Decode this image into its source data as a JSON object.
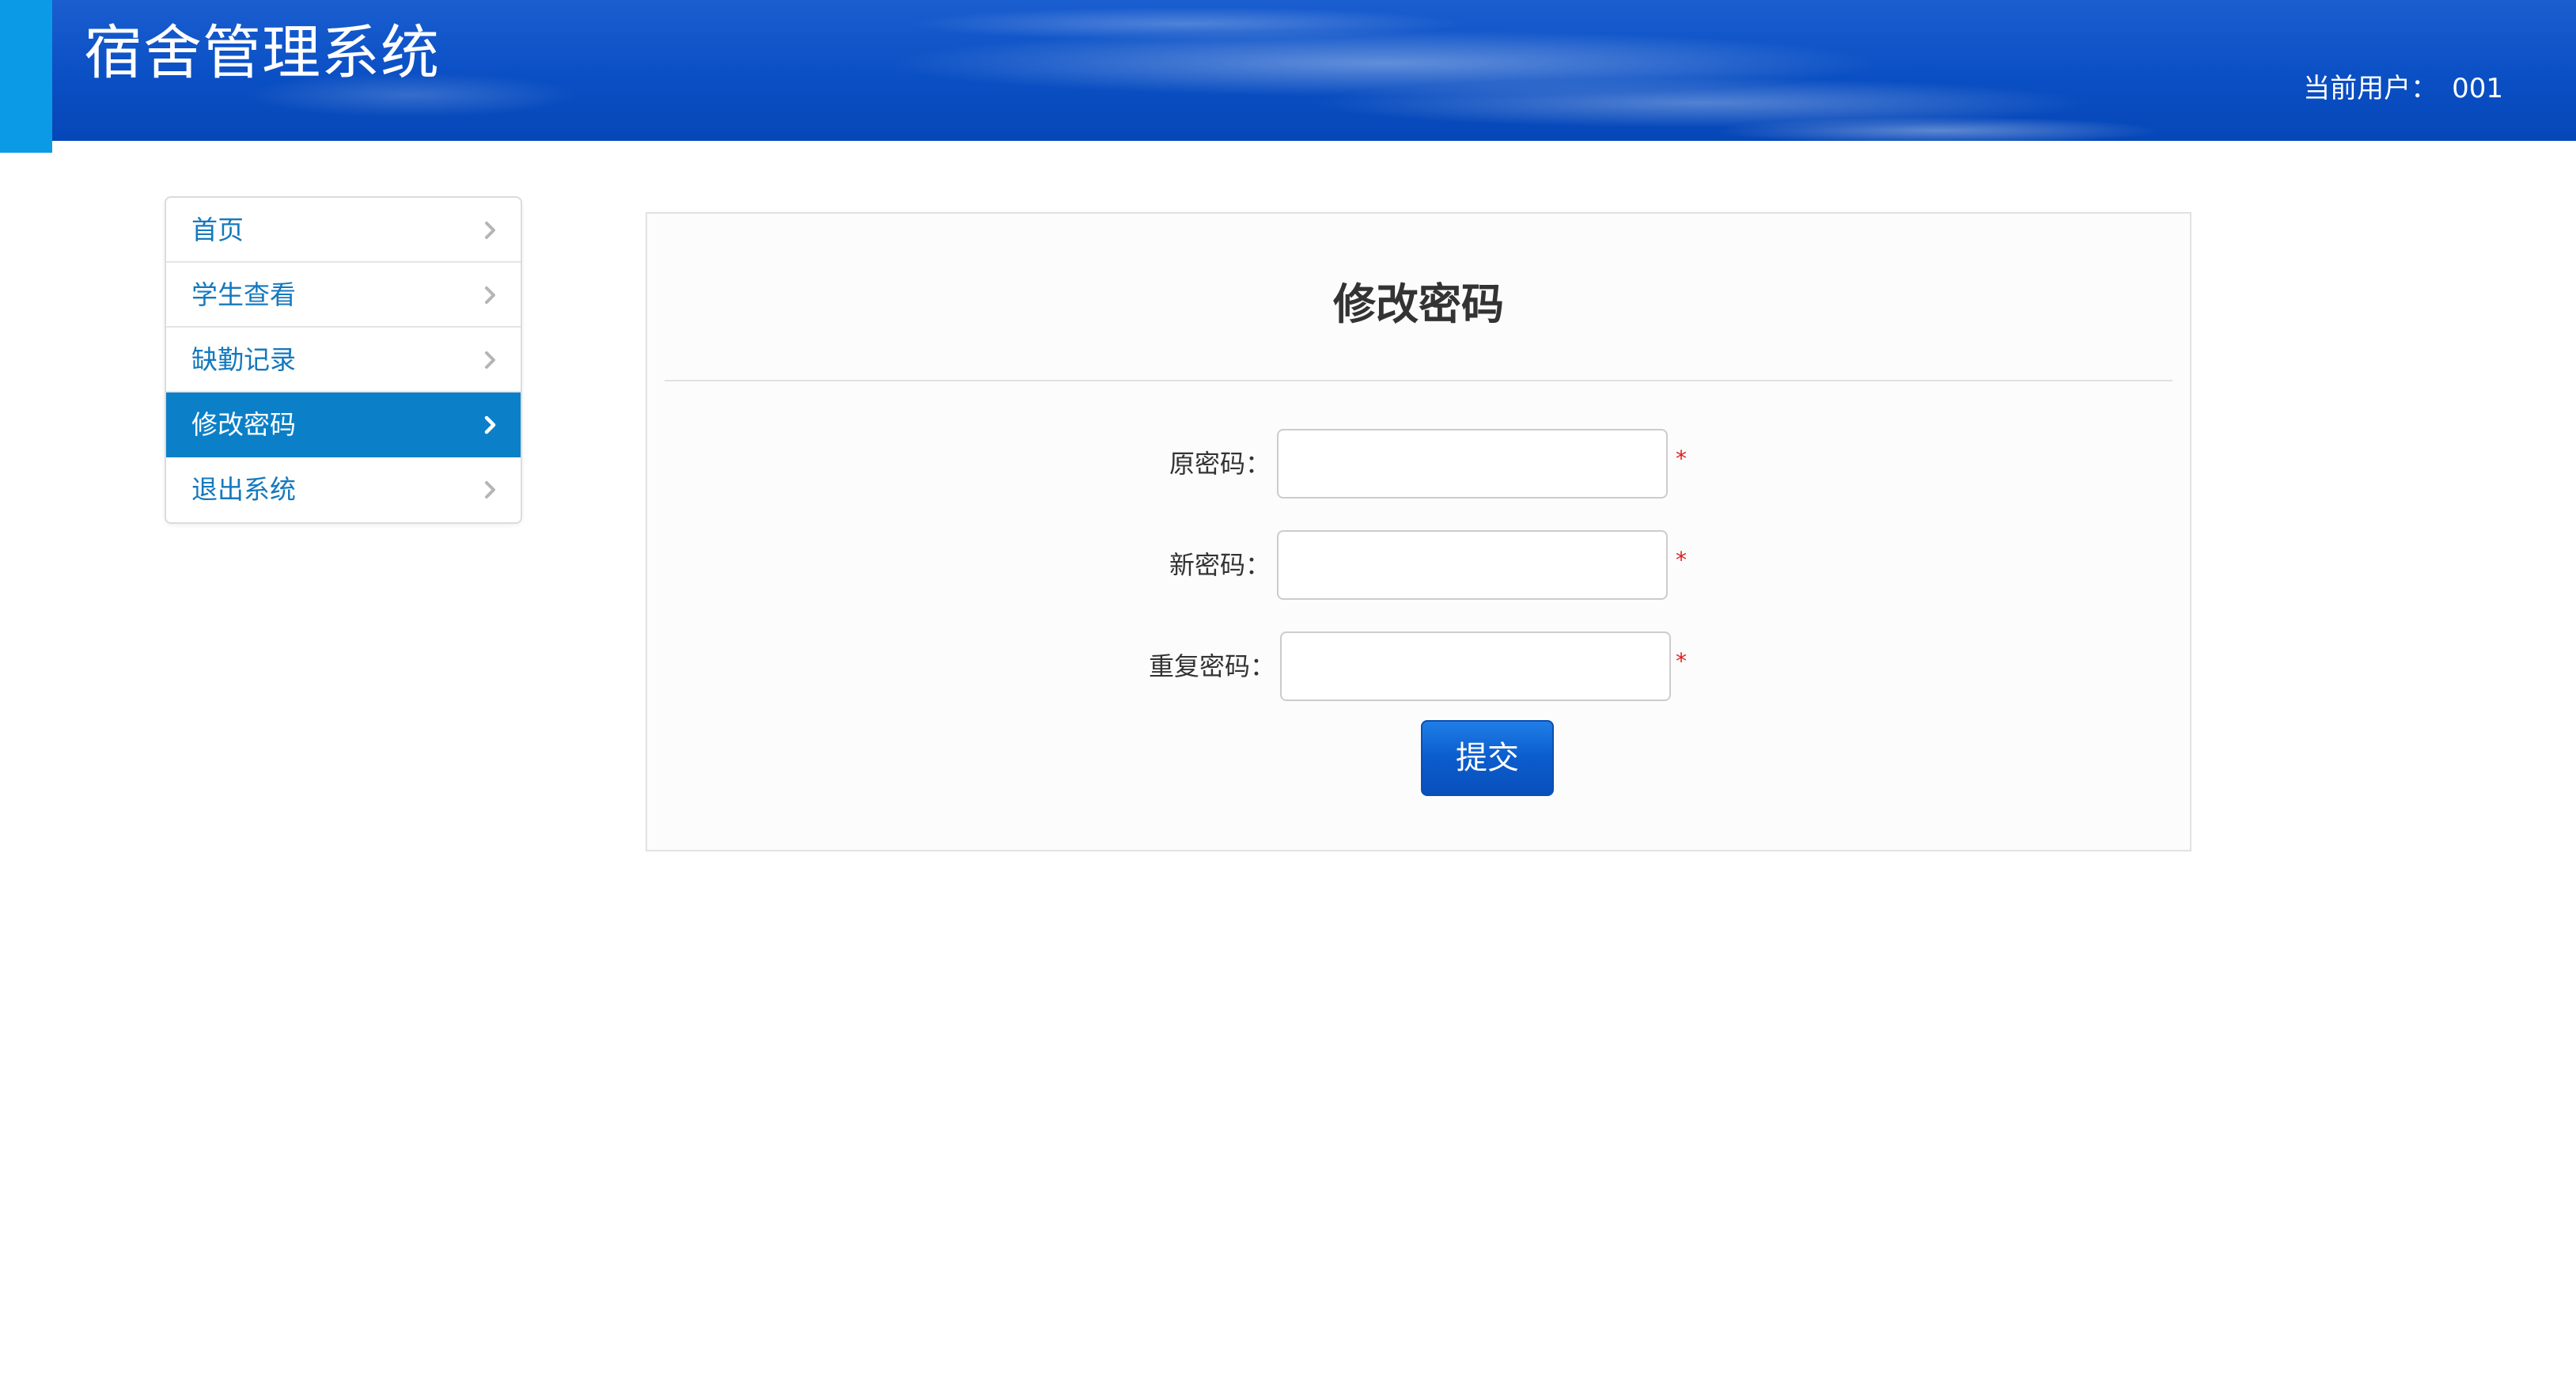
{
  "header": {
    "title": "宿舍管理系统",
    "current_user_label": "当前用户：",
    "current_user_value": "001"
  },
  "sidebar": {
    "items": [
      {
        "label": "首页",
        "active": false
      },
      {
        "label": "学生查看",
        "active": false
      },
      {
        "label": "缺勤记录",
        "active": false
      },
      {
        "label": "修改密码",
        "active": true
      },
      {
        "label": "退出系统",
        "active": false
      }
    ]
  },
  "form": {
    "title": "修改密码",
    "fields": [
      {
        "label": "原密码：",
        "value": "",
        "required_mark": "*"
      },
      {
        "label": "新密码：",
        "value": "",
        "required_mark": "*"
      },
      {
        "label": "重复密码：",
        "value": "",
        "required_mark": "*"
      }
    ],
    "submit_label": "提交"
  },
  "icons": {
    "nav_chevron": "chevron-right-icon"
  },
  "colors": {
    "header_blue": "#0a4fc4",
    "accent_cyan": "#0b9be6",
    "nav_active": "#0b80c8",
    "nav_text": "#1479be",
    "required": "#e02020",
    "button_blue": "#0b5ccd"
  }
}
